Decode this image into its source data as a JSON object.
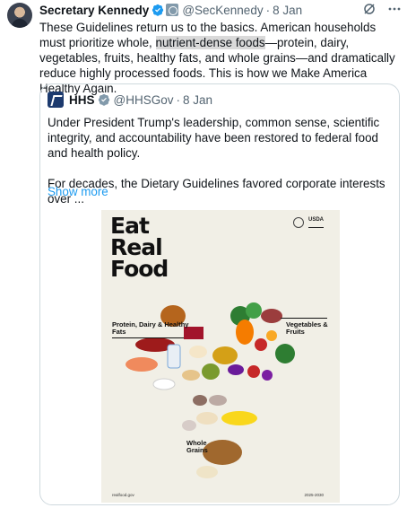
{
  "tweet": {
    "display_name": "Secretary Kennedy",
    "handle": "@SecKennedy",
    "separator": "·",
    "date": "8 Jan",
    "text_before": "These Guidelines return us to the basics. American households must prioritize whole, ",
    "text_highlight": "nutrient-dense foods",
    "text_after": "—protein, dairy, vegetables, fruits, healthy fats, and whole grains—and dramatically reduce highly processed foods. This is how we Make America Healthy Again."
  },
  "icons": {
    "verified": "verified-badge-icon",
    "gov": "government-badge-icon",
    "grok": "grok-icon",
    "more": "more-options-icon"
  },
  "quote": {
    "display_name": "HHS",
    "handle": "@HHSGov",
    "separator": "·",
    "date": "8 Jan",
    "paragraph1": "Under President Trump's leadership, common sense, scientific integrity, and accountability have been restored to federal food and health policy.",
    "paragraph2": "For decades, the Dietary Guidelines favored corporate interests over ...",
    "show_more": "Show more"
  },
  "poster": {
    "title_line1": "Eat",
    "title_line2": "Real",
    "title_line3": "Food",
    "seal_usda": "USDA",
    "category_left": "Protein, Dairy & Healthy Fats",
    "category_right": "Vegetables & Fruits",
    "category_bottom": "Whole Grains",
    "footer_left": "realfood.gov",
    "footer_right": "2025-2030"
  },
  "colors": {
    "accent": "#1d9bf0",
    "verified": "#1d9bf0",
    "muted": "#536471",
    "poster_bg": "#f1efe6"
  }
}
